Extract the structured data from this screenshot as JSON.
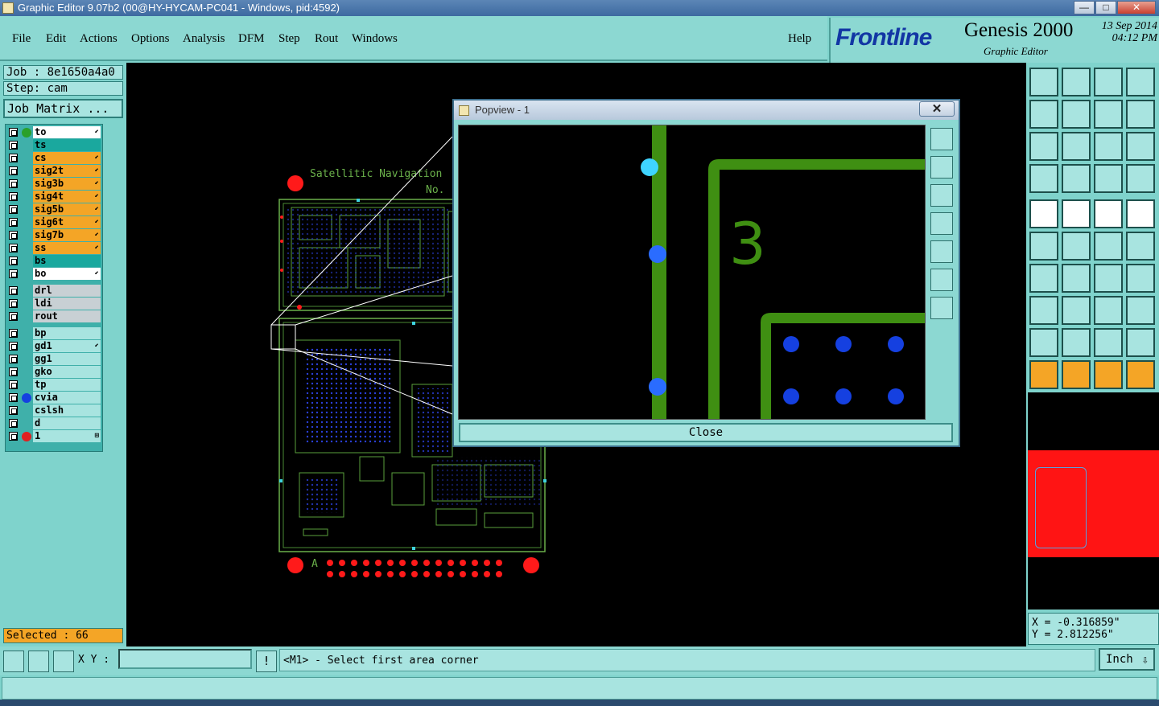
{
  "window": {
    "title": "Graphic Editor 9.07b2 (00@HY-HYCAM-PC041 - Windows, pid:4592)",
    "minimize": "—",
    "maximize": "□",
    "close": "✕"
  },
  "menu": {
    "items": [
      "File",
      "Edit",
      "Actions",
      "Options",
      "Analysis",
      "DFM",
      "Step",
      "Rout",
      "Windows"
    ],
    "help": "Help"
  },
  "brand": {
    "logo": "Frontline",
    "product": "Genesis 2000",
    "subtitle": "Graphic Editor",
    "date": "13 Sep 2014",
    "time": "04:12 PM"
  },
  "job": {
    "job_label": "Job : 8e1650a4a0",
    "step_label": "Step: cam",
    "matrix_button": "Job Matrix ..."
  },
  "layers": [
    {
      "name": "to",
      "color": "#ffffff",
      "dot": "#2aa02a",
      "edit": "⬋"
    },
    {
      "name": "ts",
      "color": "#1aa89e",
      "dot": "",
      "edit": ""
    },
    {
      "name": "cs",
      "color": "#f4a526",
      "dot": "",
      "edit": "⬋"
    },
    {
      "name": "sig2t",
      "color": "#f4a526",
      "dot": "",
      "edit": "⬋"
    },
    {
      "name": "sig3b",
      "color": "#f4a526",
      "dot": "",
      "edit": "⬋"
    },
    {
      "name": "sig4t",
      "color": "#f4a526",
      "dot": "",
      "edit": "⬋"
    },
    {
      "name": "sig5b",
      "color": "#f4a526",
      "dot": "",
      "edit": "⬋"
    },
    {
      "name": "sig6t",
      "color": "#f4a526",
      "dot": "",
      "edit": "⬋"
    },
    {
      "name": "sig7b",
      "color": "#f4a526",
      "dot": "",
      "edit": "⬋"
    },
    {
      "name": "ss",
      "color": "#f4a526",
      "dot": "",
      "edit": "⬋"
    },
    {
      "name": "bs",
      "color": "#1aa89e",
      "dot": "",
      "edit": ""
    },
    {
      "name": "bo",
      "color": "#ffffff",
      "dot": "",
      "edit": "⬋"
    },
    {
      "name": "drl",
      "color": "#c8d0d4",
      "dot": "",
      "edit": ""
    },
    {
      "name": "ldi",
      "color": "#c8d0d4",
      "dot": "",
      "edit": ""
    },
    {
      "name": "rout",
      "color": "#c8d0d4",
      "dot": "",
      "edit": ""
    },
    {
      "name": "bp",
      "color": "#a8e4e0",
      "dot": "",
      "edit": ""
    },
    {
      "name": "gd1",
      "color": "#a8e4e0",
      "dot": "",
      "edit": "⬋"
    },
    {
      "name": "gg1",
      "color": "#a8e4e0",
      "dot": "",
      "edit": ""
    },
    {
      "name": "gko",
      "color": "#a8e4e0",
      "dot": "",
      "edit": ""
    },
    {
      "name": "tp",
      "color": "#a8e4e0",
      "dot": "",
      "edit": ""
    },
    {
      "name": "cvia",
      "color": "#a8e4e0",
      "dot": "#1540e0",
      "edit": ""
    },
    {
      "name": "cslsh",
      "color": "#a8e4e0",
      "dot": "",
      "edit": ""
    },
    {
      "name": "d",
      "color": "#a8e4e0",
      "dot": "",
      "edit": ""
    },
    {
      "name": "1",
      "color": "#a8e4e0",
      "dot": "#e02020",
      "edit": "⊞"
    }
  ],
  "selected": "Selected : 66",
  "board": {
    "title": "Satellitic Navigation",
    "no": "No.",
    "marker": "A"
  },
  "popview": {
    "title": "Popview - 1",
    "close_x": "✕",
    "number": "3",
    "close_button": "Close"
  },
  "coords": {
    "x": "X = -0.316859\"",
    "y": "Y = 2.812256\""
  },
  "toolbar": {
    "xy_label": "X Y :",
    "xy_value": "",
    "alert": "!",
    "prompt": "<M1> - Select first area corner",
    "units": "Inch"
  }
}
